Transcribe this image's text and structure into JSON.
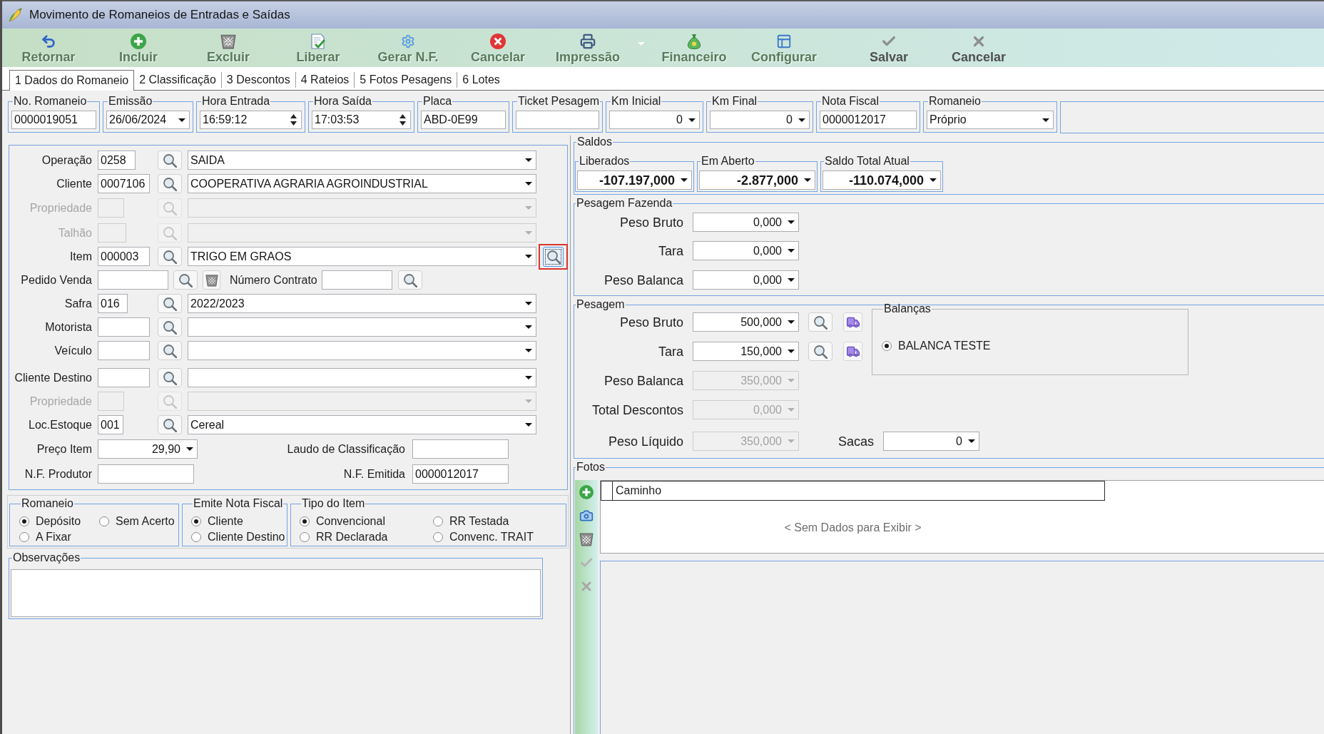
{
  "window": {
    "title": "Movimento de Romaneios de Entradas e Saídas"
  },
  "toolbar": {
    "actions": [
      {
        "label": "Retornar",
        "disabled": true,
        "dropdown": false
      },
      {
        "label": "Incluir",
        "disabled": true,
        "dropdown": false
      },
      {
        "label": "Excluir",
        "disabled": true,
        "dropdown": false
      },
      {
        "label": "Liberar",
        "disabled": true,
        "dropdown": false
      },
      {
        "label": "Gerar N.F.",
        "disabled": true,
        "dropdown": false
      },
      {
        "label": "Cancelar",
        "disabled": true,
        "dropdown": false
      },
      {
        "label": "Impressão",
        "disabled": true,
        "dropdown": true
      },
      {
        "label": "Financeiro",
        "disabled": true,
        "dropdown": false
      },
      {
        "label": "Configurar",
        "disabled": true,
        "dropdown": false
      }
    ],
    "edit_actions": [
      {
        "label": "Salvar",
        "disabled": false
      },
      {
        "label": "Cancelar",
        "disabled": false
      }
    ]
  },
  "tabs": [
    {
      "label": "1 Dados do Romaneio",
      "selected": true
    },
    {
      "label": "2 Classificação",
      "selected": false
    },
    {
      "label": "3 Descontos",
      "selected": false
    },
    {
      "label": "4 Rateios",
      "selected": false
    },
    {
      "label": "5 Fotos Pesagens",
      "selected": false
    },
    {
      "label": "6 Lotes",
      "selected": false
    }
  ],
  "header_fields": [
    {
      "label": "No. Romaneio",
      "kind": "text",
      "value": "0000019051"
    },
    {
      "label": "Emissão",
      "kind": "date",
      "value": "26/06/2024"
    },
    {
      "label": "Hora Entrada",
      "kind": "time",
      "value": "16:59:12"
    },
    {
      "label": "Hora Saída",
      "kind": "time",
      "value": "17:03:53"
    },
    {
      "label": "Placa",
      "kind": "text",
      "value": "ABD-0E99"
    },
    {
      "label": "Ticket Pesagem",
      "kind": "text"
    },
    {
      "label": "Km Inicial",
      "kind": "number",
      "value": "0"
    },
    {
      "label": "Km Final",
      "kind": "number",
      "value": "0"
    },
    {
      "label": "Nota Fiscal",
      "kind": "text",
      "value": "0000012017"
    },
    {
      "label": "Romaneio",
      "kind": "select",
      "value": "Próprio"
    }
  ],
  "form": {
    "rows": [
      {
        "kind": "lookup",
        "label": "Operação",
        "code": "0258",
        "description": "SAIDA",
        "disabled": false,
        "extra_button": false
      },
      {
        "kind": "lookup",
        "label": "Cliente",
        "code": "0007106",
        "description": "COOPERATIVA AGRARIA AGROINDUSTRIAL",
        "disabled": false,
        "extra_button": false
      },
      {
        "kind": "lookup",
        "label": "Propriedade",
        "disabled": true,
        "extra_button": false
      },
      {
        "kind": "lookup",
        "label": "Talhão",
        "disabled": true,
        "extra_button": false
      },
      {
        "kind": "lookup",
        "label": "Item",
        "code": "000003",
        "description": "TRIGO EM GRAOS",
        "disabled": false,
        "extra_button": true
      },
      {
        "kind": "order",
        "label": "Pedido Venda",
        "contract_label": "Número Contrato"
      },
      {
        "kind": "lookup",
        "label": "Safra",
        "code": "016",
        "description": "2022/2023",
        "disabled": false,
        "extra_button": false
      },
      {
        "kind": "lookup",
        "label": "Motorista",
        "disabled": false,
        "extra_button": false
      },
      {
        "kind": "lookup",
        "label": "Veículo",
        "disabled": false,
        "extra_button": false
      },
      {
        "kind": "lookup",
        "label": "Cliente Destino",
        "disabled": false,
        "extra_button": false
      },
      {
        "kind": "lookup",
        "label": "Propriedade",
        "disabled": true,
        "extra_button": false
      },
      {
        "kind": "lookup",
        "label": "Loc.Estoque",
        "code": "001",
        "description": "Cereal",
        "disabled": false,
        "extra_button": false
      },
      {
        "kind": "price",
        "label": "Preço Item",
        "value": "29,90",
        "side_label": "Laudo de Classificação"
      },
      {
        "kind": "nf",
        "label": "N.F. Produtor",
        "side_label": "N.F. Emitida",
        "side_value": "0000012017"
      }
    ]
  },
  "radio_groups": [
    {
      "title": "Romaneio",
      "options": [
        {
          "label": "Depósito",
          "selected": true
        },
        {
          "label": "Sem Acerto",
          "selected": false
        },
        {
          "label": "A Fixar",
          "selected": false
        }
      ]
    },
    {
      "title": "Emite Nota Fiscal",
      "options": [
        {
          "label": "Cliente",
          "selected": true
        },
        {
          "label": "Cliente Destino",
          "selected": false
        }
      ]
    },
    {
      "title": "Tipo do Item",
      "options": [
        {
          "label": "Convencional",
          "selected": true
        },
        {
          "label": "RR Testada",
          "selected": false
        },
        {
          "label": "RR Declarada",
          "selected": false
        },
        {
          "label": "Convenc. TRAIT",
          "selected": false
        }
      ]
    }
  ],
  "observations": {
    "title": "Observações"
  },
  "saldos": {
    "title": "Saldos",
    "items": [
      {
        "label": "Liberados",
        "value": "-107.197,000"
      },
      {
        "label": "Em Aberto",
        "value": "-2.877,000"
      },
      {
        "label": "Saldo Total Atual",
        "value": "-110.074,000"
      }
    ]
  },
  "pesagem_fazenda": {
    "title": "Pesagem Fazenda",
    "fields": [
      {
        "label": "Peso Bruto",
        "value": "0,000",
        "disabled": false
      },
      {
        "label": "Tara",
        "value": "0,000",
        "disabled": false
      },
      {
        "label": "Peso Balanca",
        "value": "0,000",
        "disabled": false
      }
    ]
  },
  "pesagem": {
    "title": "Pesagem",
    "fields": [
      {
        "label": "Peso Bruto",
        "value": "500,000",
        "disabled": false,
        "scale_buttons": true
      },
      {
        "label": "Tara",
        "value": "150,000",
        "disabled": false,
        "scale_buttons": true
      },
      {
        "label": "Peso Balanca",
        "value": "350,000",
        "disabled": true,
        "scale_buttons": false
      },
      {
        "label": "Total Descontos",
        "value": "0,000",
        "disabled": true,
        "scale_buttons": false
      },
      {
        "label": "Peso Líquido",
        "value": "350,000",
        "disabled": true,
        "scale_buttons": false
      }
    ],
    "sacas": {
      "label": "Sacas",
      "value": "0"
    },
    "balancas": {
      "title": "Balanças",
      "options": [
        {
          "label": "BALANCA TESTE",
          "selected": true
        }
      ]
    }
  },
  "fotos": {
    "title": "Fotos",
    "tools": [
      {
        "disabled": false
      },
      {
        "disabled": false
      },
      {
        "disabled": false
      },
      {
        "disabled": true
      },
      {
        "disabled": true
      }
    ],
    "columns": [
      "Caminho"
    ],
    "empty_text": "< Sem Dados para Exibir >"
  }
}
